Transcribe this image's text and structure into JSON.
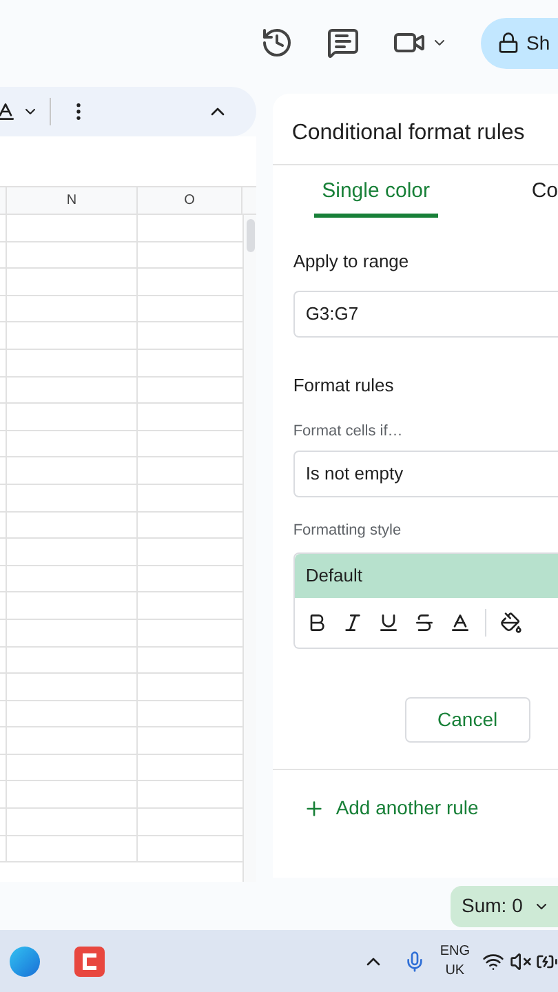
{
  "top_bar": {
    "share_button": "Sh"
  },
  "sheet": {
    "columns": [
      "N",
      "O"
    ]
  },
  "panel": {
    "title": "Conditional format rules",
    "tabs": [
      {
        "label": "Single color",
        "selected": true
      },
      {
        "label": "Co",
        "selected": false
      }
    ],
    "range_label": "Apply to range",
    "range_value": "G3:G7",
    "rules_heading": "Format rules",
    "condition_label": "Format cells if…",
    "condition_value": "Is not empty",
    "style_label": "Formatting style",
    "style_preview": "Default",
    "cancel_button": "Cancel",
    "add_rule": "Add another rule"
  },
  "status_bar": {
    "sum": "Sum: 0"
  },
  "taskbar": {
    "language": "ENG",
    "region": "UK"
  }
}
